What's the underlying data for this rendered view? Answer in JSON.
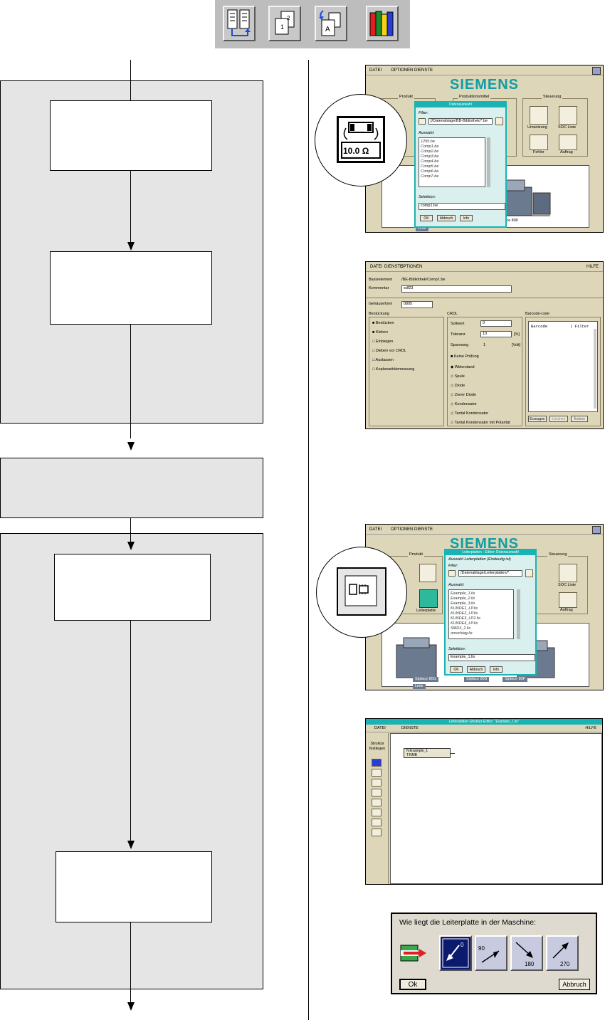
{
  "screen1": {
    "menu": [
      "DATEI",
      "OPTIONEN",
      "DIENSTE"
    ],
    "brand": "SIEMENS",
    "groups": [
      "Produkt",
      "Produktionsmittel",
      "Steuerung"
    ],
    "dialog_title": "Datenauswahl",
    "filter_label": "Filter:",
    "filter_value": "[/Datenablage/BB-Bibliothek/*.be",
    "auswahl_label": "Auswahl:",
    "items": [
      "1295.be",
      "Comp1.be",
      "Comp2.be",
      "Comp3.be",
      "Comp4.be",
      "Comp5.be",
      "Comp6.be",
      "Comp7.be"
    ],
    "selektion_label": "Selektion:",
    "selektion_value": "comp1.be",
    "buttons": [
      "OK",
      "Abbruch",
      "Info"
    ],
    "steuer_buttons": [
      "Umsetzung",
      "SOC Linie",
      "Fehler",
      "Auftrag"
    ],
    "zoom_value": "10.0",
    "bottom_label": "Linie",
    "bottom_right": "place 800"
  },
  "screen2": {
    "menu": [
      "DATEI",
      "DIENSTE",
      "OPTIONEN"
    ],
    "help": "HILFE",
    "row_basiselement_label": "Basiselement",
    "row_basiselement_value": "/BE-Bibliothek/Comp1.be",
    "row_kommentar_label": "Kommentar",
    "row_kommentar_value": "sdf23",
    "row_gehaeuse_label": "Gehäuseform",
    "row_gehaeuse_value": "0805",
    "bestueckung_title": "Bestückung",
    "bestueckung_items": [
      "Bestücken",
      "Kleben",
      "Einbiegen",
      "Dieben vor CRDL",
      "Auslassen",
      "Koplanaritätsmessung"
    ],
    "crdl_title": "CRDL",
    "sollwert_label": "Sollwert",
    "sollwert_value": "0",
    "toleranz_label": "Toleranz",
    "toleranz_value": "10",
    "toleranz_unit": "[%]",
    "spannung_label": "Spannung",
    "spannung_value": "1",
    "spannung_unit": "[Volt]",
    "keine_pruefung": "Keine Prüfung",
    "crdl_items": [
      "Widerstand",
      "Spule",
      "Diode",
      "Zener Diode",
      "Kondensator",
      "Tantal Kondensator",
      "Tantal Kondensator mit Polarität"
    ],
    "barcode_title": "Barcode-Liste",
    "barcode_header": "Barcode",
    "barcode_filter": "| Filter",
    "barcode_buttons": [
      "Erzeugen",
      "Löschen",
      "Ändern"
    ]
  },
  "screen3": {
    "menu": [
      "DATEI",
      "OPTIONEN",
      "DIENSTE"
    ],
    "brand": "SIEMENS",
    "groups": [
      "Produkt",
      "Steuerung"
    ],
    "dialog_title": "Leiterplatten - Editor: Datenauswahl",
    "subtitle": "Auswahl Leiterplatten (Eindeutig ist)",
    "filter_label": "Filter:",
    "filter_value": "/Datenablage/Leiterplatten/*",
    "auswahl_label": "Auswahl:",
    "items": [
      "Example_1.lis",
      "Example_2.lis",
      "Example_3.lis",
      "KUNDE1_LP.lis",
      "KUNDE2_LP.lis",
      "KUNDE3_LP2.lis",
      "KUNDE4_LP.lis",
      "SMD3_2.lis",
      "ornschlag.lis"
    ],
    "selektion_label": "Selektion:",
    "selektion_value": "Example_1.lis",
    "buttons": [
      "OK",
      "Abbruch",
      "Info"
    ],
    "steuer_buttons": [
      "SOC Linie",
      "Auftrag"
    ],
    "left_buttons": [
      "Leiterplatte"
    ],
    "bottom_labels": [
      "Siplace 80G",
      "Siplace 80S",
      "Siplace 80F"
    ],
    "linie": "Linie"
  },
  "screen4": {
    "title": "Leiterplatten-Struktur-Editor: \"Example_1.lis\"",
    "menu": [
      "DATEI",
      "DIENSTE"
    ],
    "help": "HILFE",
    "sidebar_title": "Struktur festlegen",
    "node_label": "N:Example_1",
    "node_sub": "T:NMB"
  },
  "screen5": {
    "question": "Wie liegt die Leiterplatte in der Maschine:",
    "angles": [
      "0",
      "90",
      "180",
      "270"
    ],
    "ok": "Ok",
    "cancel": "Abbruch"
  },
  "colors": {
    "siemens_teal": "#0f9ea6",
    "dialog_teal": "#19b3b3",
    "panel_gray": "#e5e5e5",
    "window_beige": "#ddd6b8",
    "orient_selected": "#0c1a6e"
  },
  "icons": [
    "structure-icon",
    "layers-icon",
    "transfer-icon",
    "library-books-icon"
  ]
}
